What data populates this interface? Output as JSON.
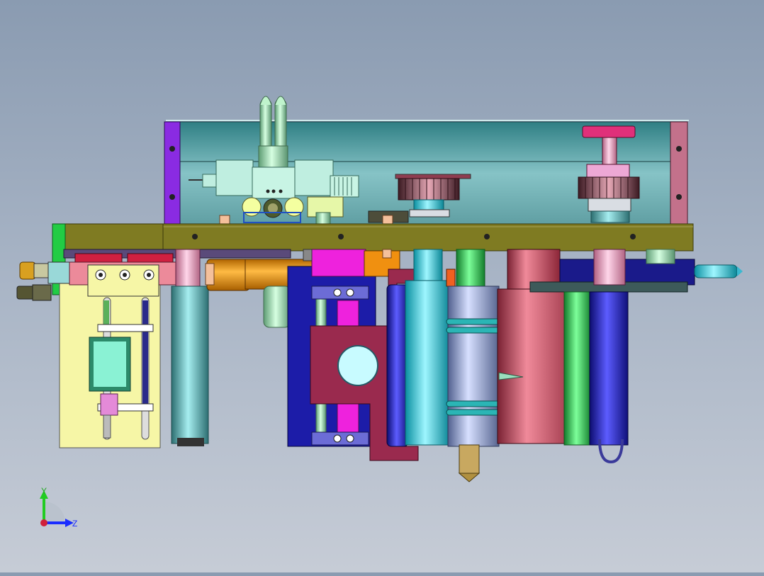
{
  "view": {
    "background_top": "#8a9bb1",
    "background_bottom": "#c6ccd6"
  },
  "triad": {
    "y_label": "Y",
    "z_label": "Z",
    "y_color": "#22cc22",
    "z_color": "#1a2cff",
    "origin_color": "#d0203a"
  },
  "colors": {
    "frame_teal": "#6fa9ad",
    "base_plate": "#7f7b22",
    "purple_plate": "#8a2be2",
    "pink_plate": "#c3718b",
    "magenta": "#ee22dd",
    "navy": "#1c1ca8",
    "maroon": "#9a2a4e",
    "cyan": "#22ddee",
    "orange": "#f09010",
    "pale_yellow": "#f6f6a6",
    "salmon": "#d95b72",
    "green": "#22cc44"
  }
}
